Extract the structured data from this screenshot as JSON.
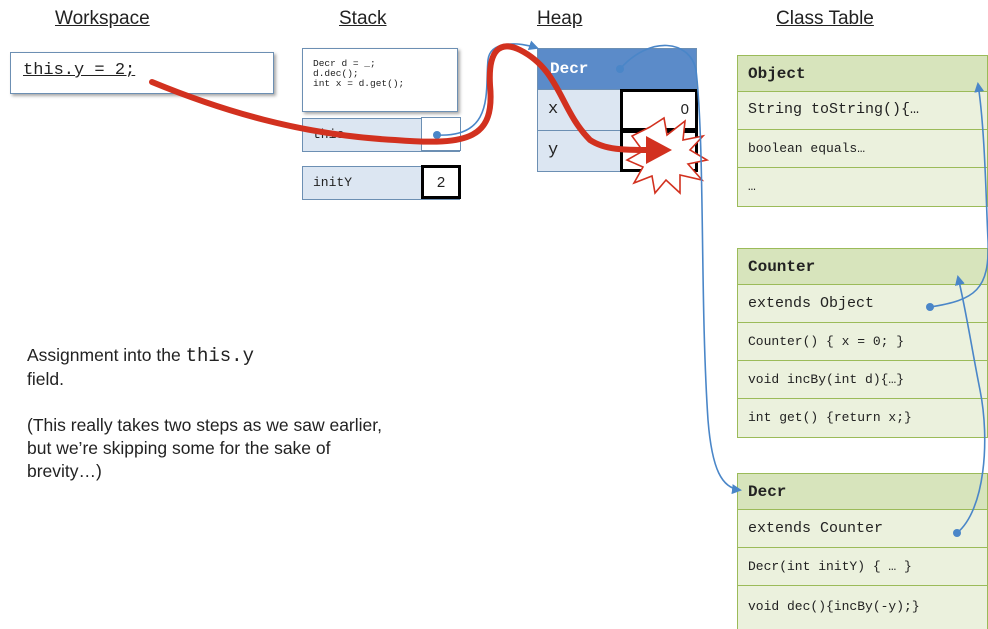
{
  "headers": {
    "workspace": "Workspace",
    "stack": "Stack",
    "heap": "Heap",
    "class_table": "Class Table"
  },
  "workspace": {
    "code": "this.y = 2;"
  },
  "stack": {
    "code_lines": [
      "Decr d = _;",
      "d.dec();",
      "int x = d.get();"
    ],
    "frames": [
      {
        "name": "this",
        "value": ""
      },
      {
        "name": "initY",
        "value": "2"
      }
    ]
  },
  "heap": {
    "object_class": "Decr",
    "fields": [
      {
        "name": "x",
        "value": "0"
      },
      {
        "name": "y",
        "value": "2"
      }
    ]
  },
  "class_table": {
    "classes": [
      {
        "name": "Object",
        "members": [
          "String toString(){…",
          "boolean equals…",
          "…"
        ]
      },
      {
        "name": "Counter",
        "members": [
          "extends Object",
          "Counter() { x = 0; }",
          "void incBy(int d){…}",
          "int get() {return x;}"
        ]
      },
      {
        "name": "Decr",
        "members": [
          "extends Counter",
          "Decr(int initY) { … }",
          "void dec(){incBy(-y);}"
        ]
      }
    ]
  },
  "caption": {
    "line1_prefix": "Assignment into the ",
    "line1_code": "this.y",
    "line2": "field.",
    "note": "(This really takes two steps as we saw earlier, but we’re skipping some for the sake of brevity…)"
  },
  "colors": {
    "pointer_arrow": "#4a86c8",
    "action_arrow": "#d2311f",
    "heap_header": "#5b8bc9",
    "heap_body": "#dce6f2",
    "class_header": "#d7e4bc",
    "class_body": "#ebf1dd"
  }
}
